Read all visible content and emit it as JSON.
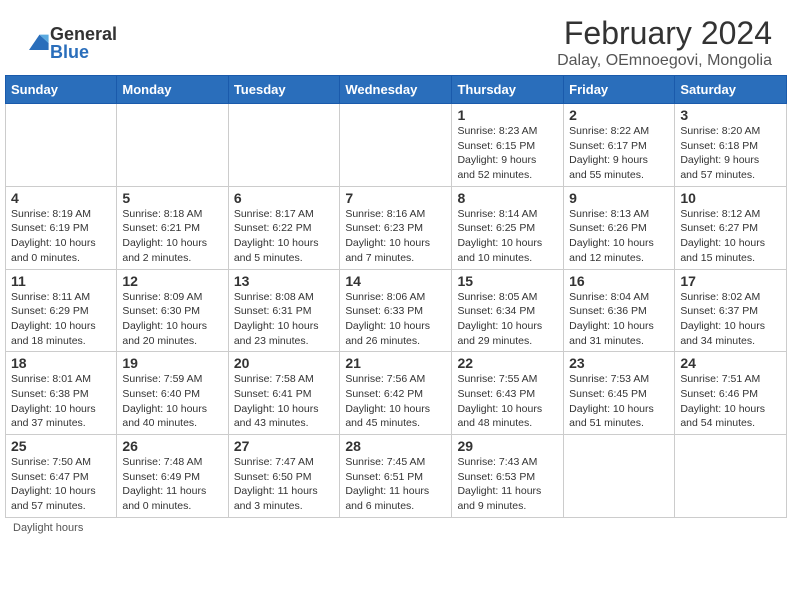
{
  "header": {
    "logo_general": "General",
    "logo_blue": "Blue",
    "title": "February 2024",
    "subtitle": "Dalay, OEmnoegovi, Mongolia"
  },
  "days_of_week": [
    "Sunday",
    "Monday",
    "Tuesday",
    "Wednesday",
    "Thursday",
    "Friday",
    "Saturday"
  ],
  "weeks": [
    [
      {
        "day": "",
        "info": ""
      },
      {
        "day": "",
        "info": ""
      },
      {
        "day": "",
        "info": ""
      },
      {
        "day": "",
        "info": ""
      },
      {
        "day": "1",
        "info": "Sunrise: 8:23 AM\nSunset: 6:15 PM\nDaylight: 9 hours\nand 52 minutes."
      },
      {
        "day": "2",
        "info": "Sunrise: 8:22 AM\nSunset: 6:17 PM\nDaylight: 9 hours\nand 55 minutes."
      },
      {
        "day": "3",
        "info": "Sunrise: 8:20 AM\nSunset: 6:18 PM\nDaylight: 9 hours\nand 57 minutes."
      }
    ],
    [
      {
        "day": "4",
        "info": "Sunrise: 8:19 AM\nSunset: 6:19 PM\nDaylight: 10 hours\nand 0 minutes."
      },
      {
        "day": "5",
        "info": "Sunrise: 8:18 AM\nSunset: 6:21 PM\nDaylight: 10 hours\nand 2 minutes."
      },
      {
        "day": "6",
        "info": "Sunrise: 8:17 AM\nSunset: 6:22 PM\nDaylight: 10 hours\nand 5 minutes."
      },
      {
        "day": "7",
        "info": "Sunrise: 8:16 AM\nSunset: 6:23 PM\nDaylight: 10 hours\nand 7 minutes."
      },
      {
        "day": "8",
        "info": "Sunrise: 8:14 AM\nSunset: 6:25 PM\nDaylight: 10 hours\nand 10 minutes."
      },
      {
        "day": "9",
        "info": "Sunrise: 8:13 AM\nSunset: 6:26 PM\nDaylight: 10 hours\nand 12 minutes."
      },
      {
        "day": "10",
        "info": "Sunrise: 8:12 AM\nSunset: 6:27 PM\nDaylight: 10 hours\nand 15 minutes."
      }
    ],
    [
      {
        "day": "11",
        "info": "Sunrise: 8:11 AM\nSunset: 6:29 PM\nDaylight: 10 hours\nand 18 minutes."
      },
      {
        "day": "12",
        "info": "Sunrise: 8:09 AM\nSunset: 6:30 PM\nDaylight: 10 hours\nand 20 minutes."
      },
      {
        "day": "13",
        "info": "Sunrise: 8:08 AM\nSunset: 6:31 PM\nDaylight: 10 hours\nand 23 minutes."
      },
      {
        "day": "14",
        "info": "Sunrise: 8:06 AM\nSunset: 6:33 PM\nDaylight: 10 hours\nand 26 minutes."
      },
      {
        "day": "15",
        "info": "Sunrise: 8:05 AM\nSunset: 6:34 PM\nDaylight: 10 hours\nand 29 minutes."
      },
      {
        "day": "16",
        "info": "Sunrise: 8:04 AM\nSunset: 6:36 PM\nDaylight: 10 hours\nand 31 minutes."
      },
      {
        "day": "17",
        "info": "Sunrise: 8:02 AM\nSunset: 6:37 PM\nDaylight: 10 hours\nand 34 minutes."
      }
    ],
    [
      {
        "day": "18",
        "info": "Sunrise: 8:01 AM\nSunset: 6:38 PM\nDaylight: 10 hours\nand 37 minutes."
      },
      {
        "day": "19",
        "info": "Sunrise: 7:59 AM\nSunset: 6:40 PM\nDaylight: 10 hours\nand 40 minutes."
      },
      {
        "day": "20",
        "info": "Sunrise: 7:58 AM\nSunset: 6:41 PM\nDaylight: 10 hours\nand 43 minutes."
      },
      {
        "day": "21",
        "info": "Sunrise: 7:56 AM\nSunset: 6:42 PM\nDaylight: 10 hours\nand 45 minutes."
      },
      {
        "day": "22",
        "info": "Sunrise: 7:55 AM\nSunset: 6:43 PM\nDaylight: 10 hours\nand 48 minutes."
      },
      {
        "day": "23",
        "info": "Sunrise: 7:53 AM\nSunset: 6:45 PM\nDaylight: 10 hours\nand 51 minutes."
      },
      {
        "day": "24",
        "info": "Sunrise: 7:51 AM\nSunset: 6:46 PM\nDaylight: 10 hours\nand 54 minutes."
      }
    ],
    [
      {
        "day": "25",
        "info": "Sunrise: 7:50 AM\nSunset: 6:47 PM\nDaylight: 10 hours\nand 57 minutes."
      },
      {
        "day": "26",
        "info": "Sunrise: 7:48 AM\nSunset: 6:49 PM\nDaylight: 11 hours\nand 0 minutes."
      },
      {
        "day": "27",
        "info": "Sunrise: 7:47 AM\nSunset: 6:50 PM\nDaylight: 11 hours\nand 3 minutes."
      },
      {
        "day": "28",
        "info": "Sunrise: 7:45 AM\nSunset: 6:51 PM\nDaylight: 11 hours\nand 6 minutes."
      },
      {
        "day": "29",
        "info": "Sunrise: 7:43 AM\nSunset: 6:53 PM\nDaylight: 11 hours\nand 9 minutes."
      },
      {
        "day": "",
        "info": ""
      },
      {
        "day": "",
        "info": ""
      }
    ]
  ],
  "footer": {
    "daylight_hours": "Daylight hours"
  }
}
